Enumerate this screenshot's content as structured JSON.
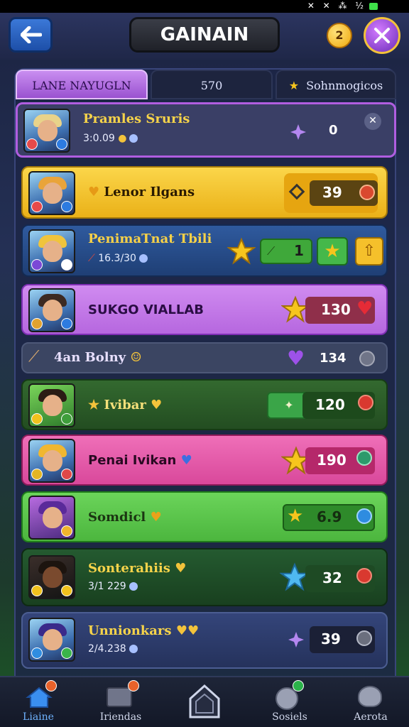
{
  "status": {
    "icons": "✕ ✕ ⁂ ½"
  },
  "header": {
    "title": "GAINAIN",
    "coin_count": "2"
  },
  "tabs": [
    {
      "label": "LANE NAYUGLN"
    },
    {
      "label": "570"
    },
    {
      "label": "Sohnmogicos"
    }
  ],
  "rows": [
    {
      "name": "Pramles Sruris",
      "sub": "3:0.09",
      "score": "0"
    },
    {
      "name": "Lenor Ilgans",
      "score": "39"
    },
    {
      "name": "PenimaTnat Tbili",
      "sub": "16.3/30",
      "score": "1"
    },
    {
      "name": "SUKGO VIALLAB",
      "score": "130"
    },
    {
      "name": "4an Bolny",
      "score": "134"
    },
    {
      "name": "Ivibar",
      "score": "120"
    },
    {
      "name": "Penai Ivikan",
      "score": "190"
    },
    {
      "name": "Somdicl",
      "score": "6.9"
    },
    {
      "name": "Sonterahiis",
      "sub": "3/1 229",
      "score": "32"
    },
    {
      "name": "Unnionkars",
      "sub": "2/4.238",
      "score": "39"
    }
  ],
  "nav": [
    {
      "label": "Liaine"
    },
    {
      "label": "Iriendas"
    },
    {
      "label": ""
    },
    {
      "label": "Sosiels"
    },
    {
      "label": "Aerota"
    }
  ],
  "colors": {
    "row1": "#3a3f66",
    "row2": "#f7c533",
    "row3": "#2a4a8a",
    "row4": "#c37de2",
    "row5": "#3b4562",
    "row6": "#2d5b2d",
    "row7": "#e55fa8",
    "row8": "#5fc74a",
    "row9": "#1f4b2a",
    "row10": "#2d3d6a"
  }
}
